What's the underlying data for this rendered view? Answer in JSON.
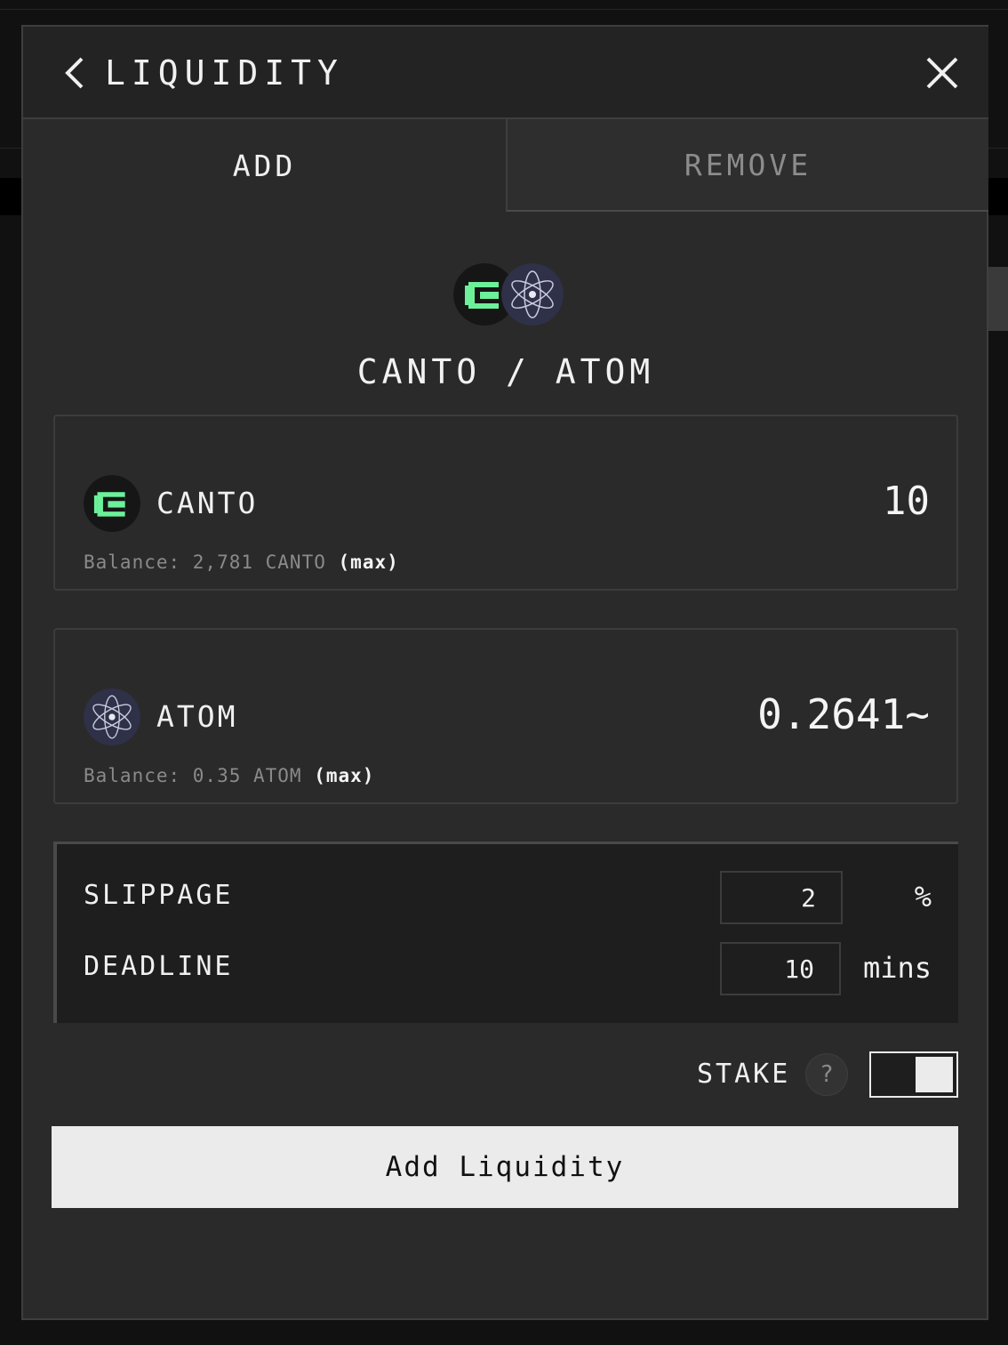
{
  "header": {
    "title": "LIQUIDITY"
  },
  "tabs": {
    "add": "ADD",
    "remove": "REMOVE",
    "active": "ADD"
  },
  "pair": {
    "name": "CANTO / ATOM"
  },
  "tokens": [
    {
      "symbol": "CANTO",
      "amount": "10",
      "balance_label": "Balance: 2,781 CANTO",
      "max_label": "(max)",
      "icon": "canto-coin-icon"
    },
    {
      "symbol": "ATOM",
      "amount": "0.2641~",
      "balance_label": "Balance: 0.35 ATOM",
      "max_label": "(max)",
      "icon": "atom-coin-icon"
    }
  ],
  "settings": {
    "slippage": {
      "label": "SLIPPAGE",
      "value": "2",
      "unit": "%"
    },
    "deadline": {
      "label": "DEADLINE",
      "value": "10",
      "unit": "mins"
    }
  },
  "stake": {
    "label": "STAKE",
    "help": "?",
    "enabled": true
  },
  "submit": {
    "label": "Add Liquidity"
  },
  "colors": {
    "canto_green": "#6cf09a",
    "atom_dark": "#2e3148",
    "button_bg": "#ebebeb",
    "panel_bg": "#2a2a2a"
  }
}
